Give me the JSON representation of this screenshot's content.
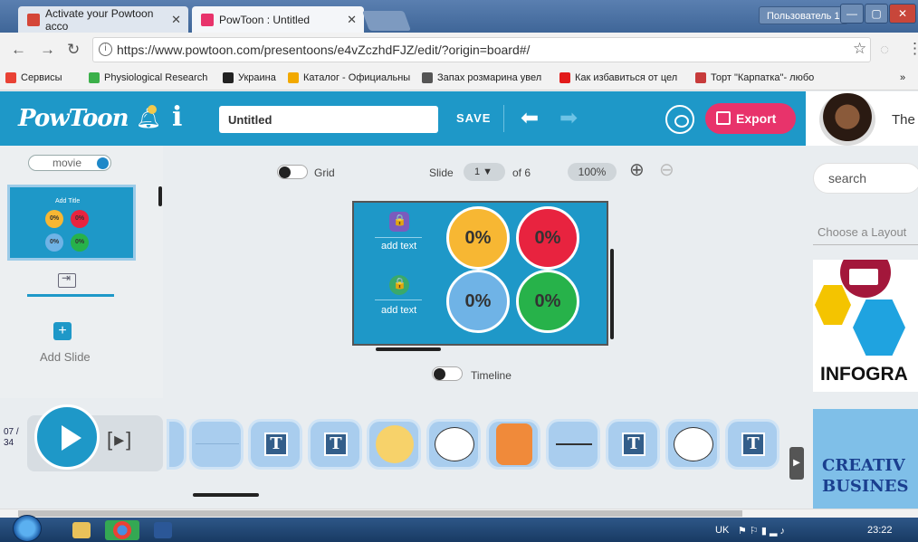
{
  "browser": {
    "tabs": [
      {
        "title": "Activate your Powtoon acco",
        "favicon_color": "#d44638"
      },
      {
        "title": "PowToon : Untitled",
        "favicon_color": "#e8336b"
      }
    ],
    "user_button": "Пользователь 1",
    "url": "https://www.powtoon.com/presentoons/e4vZczhdFJZ/edit/?origin=board#/",
    "bookmarks": [
      "Сервисы",
      "Physiological Research",
      "Украина",
      "Каталог - Официальны",
      "Запах розмарина увел",
      "Как избавиться от цел",
      "Торт \"Карпатка\"- любо"
    ],
    "more_bookmarks": "»"
  },
  "toolbar": {
    "logo": "PowToon",
    "title_value": "Untitled",
    "save_label": "SAVE",
    "export_label": "Export",
    "user_name": "The"
  },
  "left_panel": {
    "mode_label": "movie",
    "thumb_title": "Add Title",
    "thumb_values": [
      "0%",
      "0%",
      "0%",
      "0%"
    ],
    "add_slide_label": "Add Slide"
  },
  "canvas_controls": {
    "grid_label": "Grid",
    "slide_label": "Slide",
    "current_slide": "1",
    "of_label": "of 6",
    "zoom": "100%",
    "timeline_label": "Timeline"
  },
  "slide": {
    "circles": [
      {
        "value": "0%",
        "color": "#f7b733"
      },
      {
        "value": "0%",
        "color": "#e8233f"
      },
      {
        "value": "0%",
        "color": "#6fb3e6"
      },
      {
        "value": "0%",
        "color": "#27b24a"
      }
    ],
    "add_text": [
      "add text",
      "add text"
    ]
  },
  "right_panel": {
    "search_placeholder": "search",
    "layout_label": "Choose a Layout",
    "infographic_label": "INFOGRA",
    "creative_line1": "CREATIV",
    "creative_line2": "BUSINES"
  },
  "timeline": {
    "time_line1": "07 /",
    "time_line2": "34",
    "step_label": "[▸]",
    "chips": [
      "blank",
      "blank",
      "text",
      "text",
      "circle",
      "bubble",
      "lock",
      "line",
      "text",
      "bubble",
      "text"
    ]
  },
  "taskbar": {
    "lang": "UK",
    "clock": "23:22"
  }
}
